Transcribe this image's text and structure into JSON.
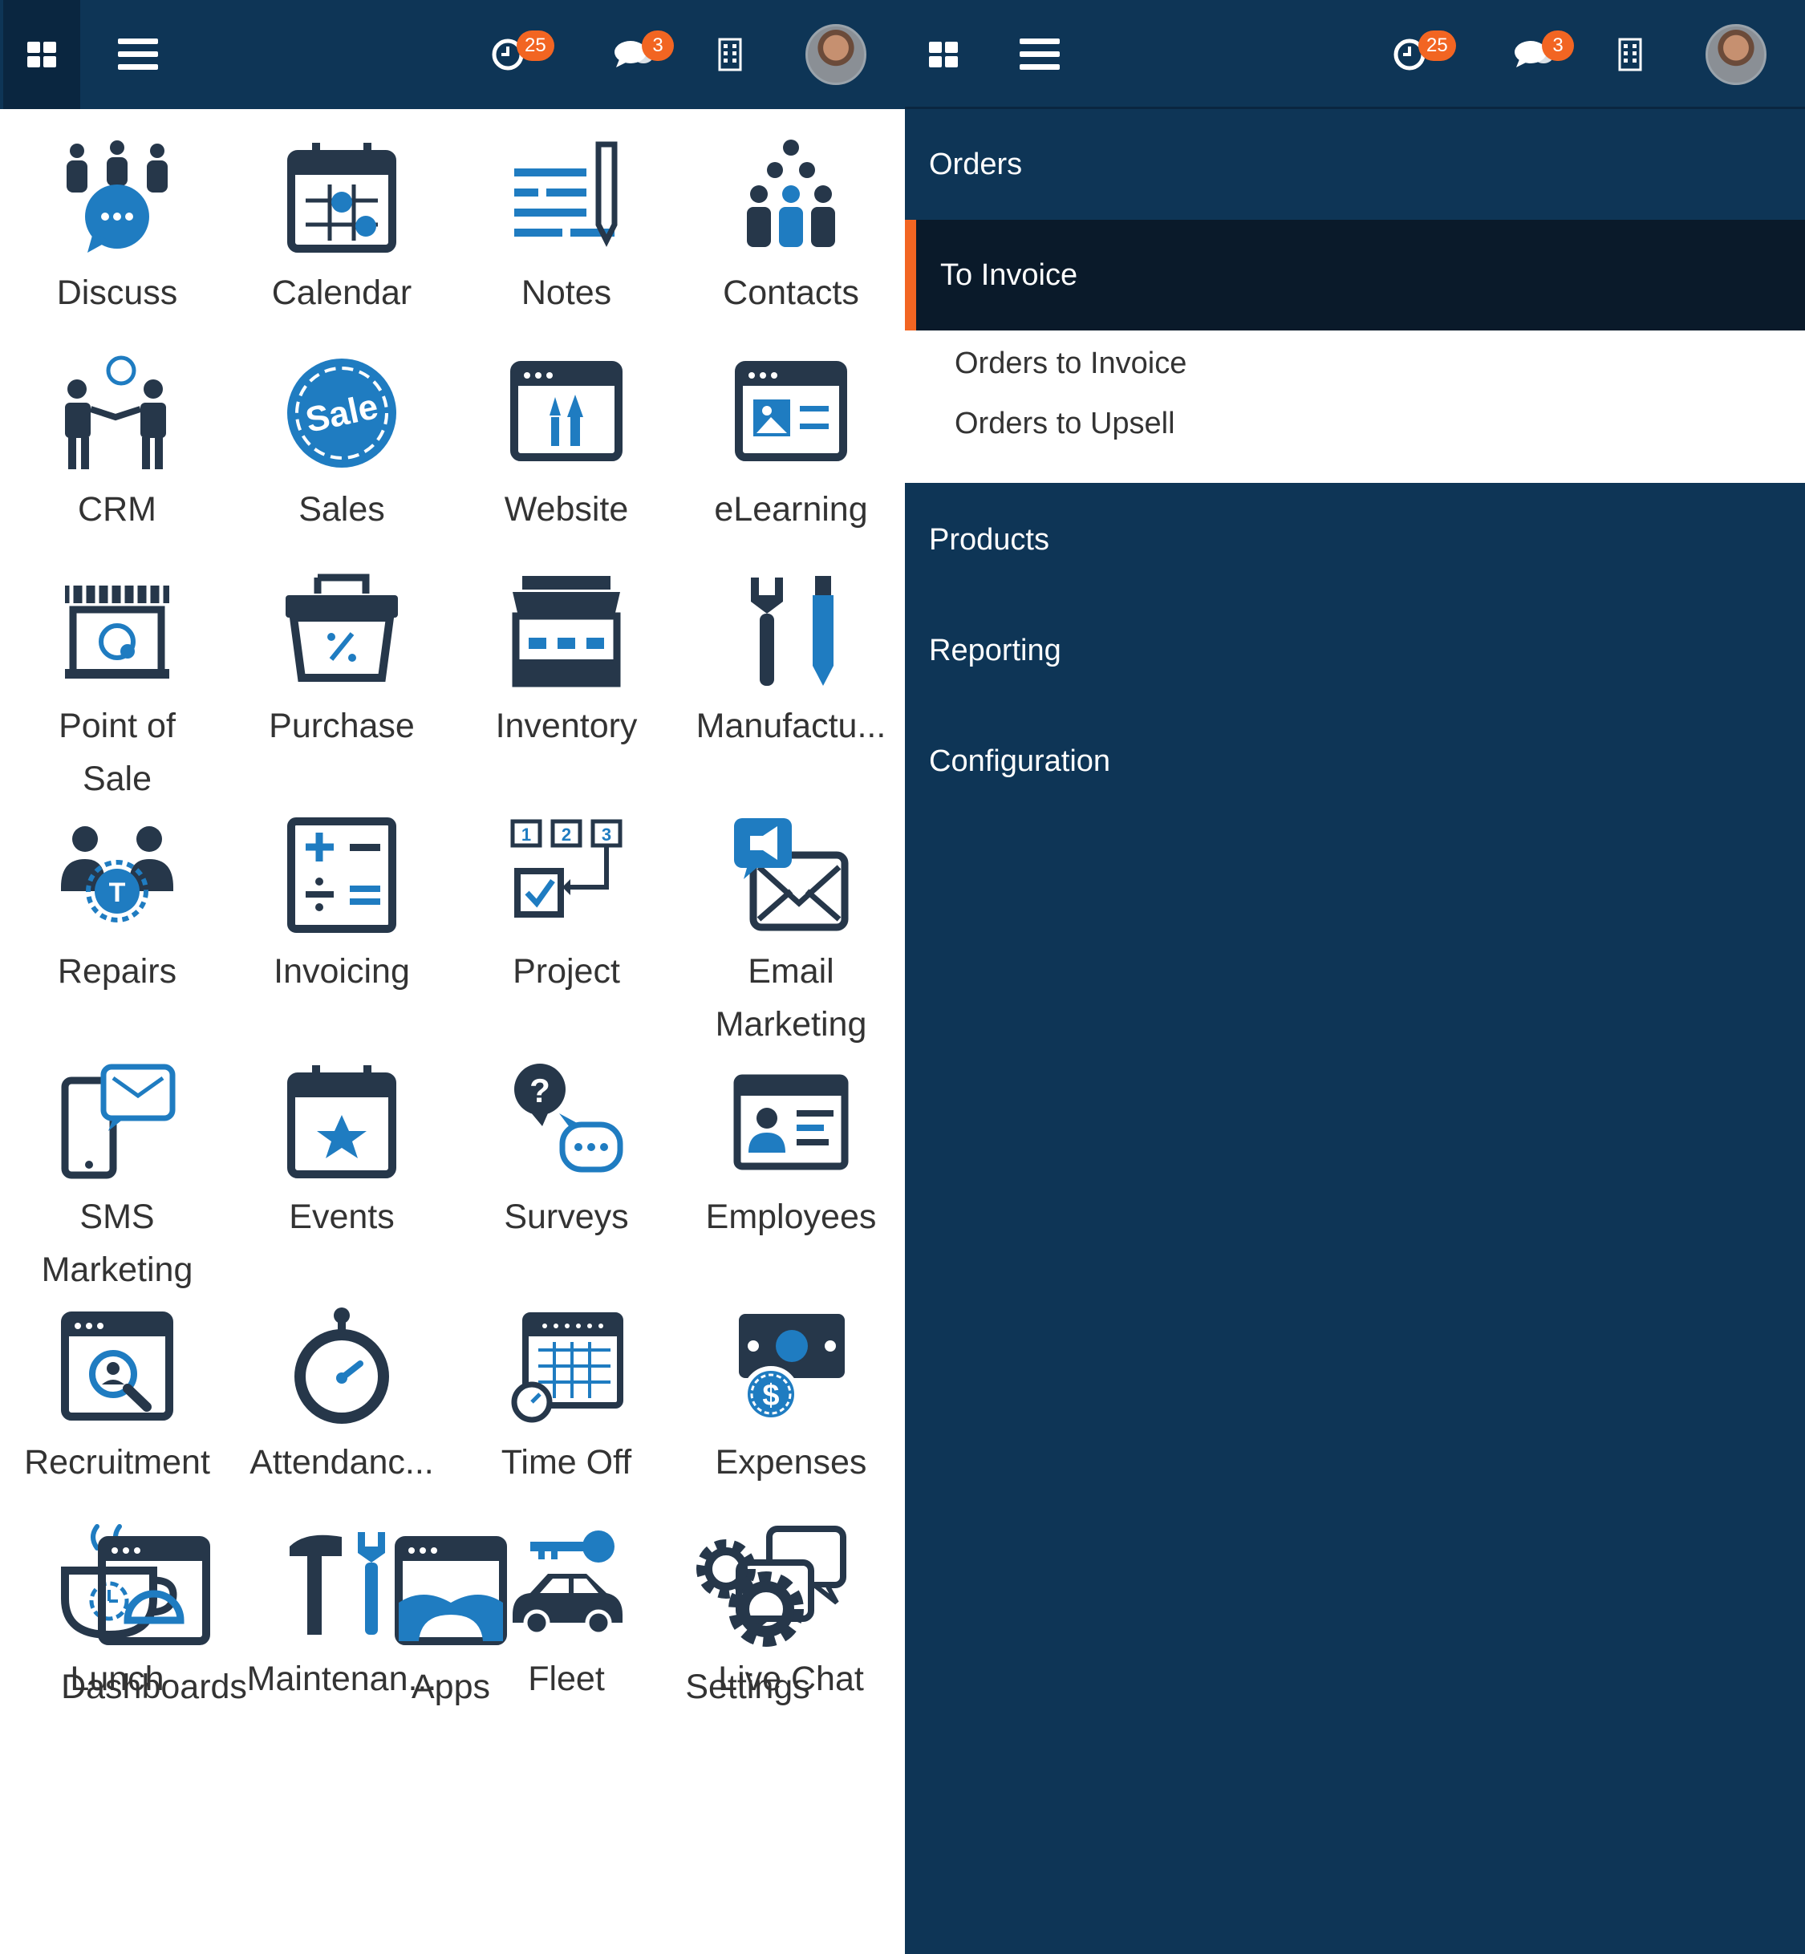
{
  "navbar_left": {
    "activity_badge": "25",
    "messages_badge": "3"
  },
  "navbar_right": {
    "activity_badge": "25",
    "messages_badge": "3"
  },
  "apps": [
    {
      "label": "Discuss",
      "icon": "discuss-icon"
    },
    {
      "label": "Calendar",
      "icon": "calendar-icon"
    },
    {
      "label": "Notes",
      "icon": "notes-icon"
    },
    {
      "label": "Contacts",
      "icon": "contacts-icon"
    },
    {
      "label": "CRM",
      "icon": "crm-icon"
    },
    {
      "label": "Sales",
      "icon": "sales-icon"
    },
    {
      "label": "Website",
      "icon": "website-icon"
    },
    {
      "label": "eLearning",
      "icon": "elearning-icon"
    },
    {
      "label": "Point of\nSale",
      "icon": "point-of-sale-icon"
    },
    {
      "label": "Purchase",
      "icon": "purchase-icon"
    },
    {
      "label": "Inventory",
      "icon": "inventory-icon"
    },
    {
      "label": "Manufactu...",
      "icon": "manufacturing-icon"
    },
    {
      "label": "Repairs",
      "icon": "repairs-icon"
    },
    {
      "label": "Invoicing",
      "icon": "invoicing-icon"
    },
    {
      "label": "Project",
      "icon": "project-icon"
    },
    {
      "label": "Email\nMarketing",
      "icon": "email-marketing-icon"
    },
    {
      "label": "SMS\nMarketing",
      "icon": "sms-marketing-icon"
    },
    {
      "label": "Events",
      "icon": "events-icon"
    },
    {
      "label": "Surveys",
      "icon": "surveys-icon"
    },
    {
      "label": "Employees",
      "icon": "employees-icon"
    },
    {
      "label": "Recruitment",
      "icon": "recruitment-icon"
    },
    {
      "label": "Attendanc...",
      "icon": "attendance-icon"
    },
    {
      "label": "Time Off",
      "icon": "time-off-icon"
    },
    {
      "label": "Expenses",
      "icon": "expenses-icon"
    },
    {
      "label": "Lunch",
      "icon": "lunch-icon"
    },
    {
      "label": "Maintenan...",
      "icon": "maintenance-icon"
    },
    {
      "label": "Fleet",
      "icon": "fleet-icon"
    },
    {
      "label": "Live Chat",
      "icon": "live-chat-icon"
    },
    {
      "label": "Dashboards",
      "icon": "dashboards-icon"
    },
    {
      "label": "Apps",
      "icon": "apps-icon"
    },
    {
      "label": "Settings",
      "icon": "settings-icon"
    }
  ],
  "menu": {
    "orders": "Orders",
    "to_invoice": "To Invoice",
    "sub_items": [
      "Orders to Invoice",
      "Orders to Upsell"
    ],
    "products": "Products",
    "reporting": "Reporting",
    "configuration": "Configuration"
  },
  "colors": {
    "navbar": "#0e3556",
    "accent": "#f26522",
    "icon_dark": "#26374a",
    "icon_blue": "#1f7cc1"
  }
}
